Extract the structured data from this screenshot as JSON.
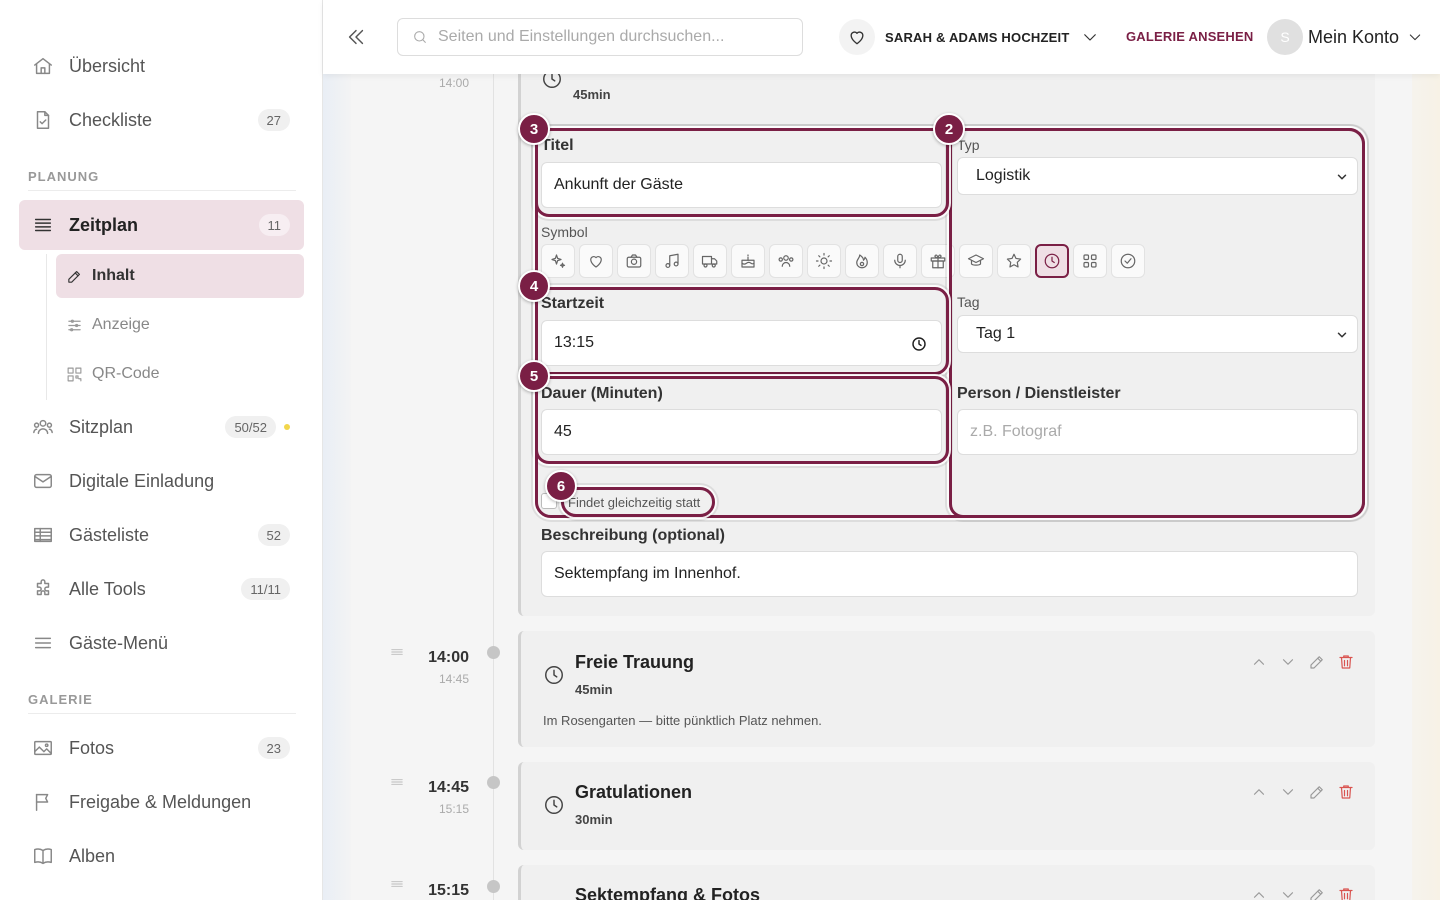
{
  "sidebar": {
    "items": [
      {
        "label": "Übersicht"
      },
      {
        "label": "Checkliste",
        "badge": "27"
      },
      {
        "label": "Zeitplan",
        "badge": "11"
      },
      {
        "label": "Sitzplan",
        "badge": "50/52"
      },
      {
        "label": "Digitale Einladung"
      },
      {
        "label": "Gästeliste",
        "badge": "52"
      },
      {
        "label": "Alle Tools",
        "badge": "11/11"
      },
      {
        "label": "Gäste-Menü"
      },
      {
        "label": "Fotos",
        "badge": "23"
      },
      {
        "label": "Freigabe & Meldungen"
      },
      {
        "label": "Alben"
      }
    ],
    "sub_items": [
      {
        "label": "Inhalt"
      },
      {
        "label": "Anzeige"
      },
      {
        "label": "QR-Code"
      }
    ],
    "sections": {
      "planung": "PLANUNG",
      "galerie": "GALERIE"
    }
  },
  "header": {
    "search_placeholder": "Seiten und Einstellungen durchsuchen...",
    "event_name": "SARAH & ADAMS HOCHZEIT",
    "gallery_link": "GALERIE ANSEHEN",
    "avatar_initial": "S",
    "account_label": "Mein Konto"
  },
  "timeline": {
    "top_sub_time": "14:00",
    "edit": {
      "duration_display": "45min",
      "title_label": "Titel",
      "title_value": "Ankunft der Gäste",
      "type_label": "Typ",
      "type_value": "Logistik",
      "symbol_label": "Symbol",
      "symbols": [
        "sparkles-icon",
        "heart-icon",
        "camera-icon",
        "music-icon",
        "truck-icon",
        "cake-icon",
        "users-icon",
        "sun-icon",
        "fire-icon",
        "microphone-icon",
        "gift-icon",
        "graduation-cap-icon",
        "star-icon",
        "clock-icon",
        "grid-icon",
        "check-circle-icon"
      ],
      "selected_symbol": "clock-icon",
      "start_label": "Startzeit",
      "start_value": "13:15",
      "day_label": "Tag",
      "day_value": "Tag 1",
      "duration_label": "Dauer (Minuten)",
      "duration_value": "45",
      "person_label": "Person / Dienstleister",
      "person_placeholder": "z.B. Fotograf",
      "simultaneous_label": "Findet gleichzeitig statt",
      "description_label": "Beschreibung (optional)",
      "description_value": "Sektempfang im Innenhof."
    },
    "entries": [
      {
        "time": "14:00",
        "end": "14:45",
        "title": "Freie Trauung",
        "duration": "45min",
        "description": "Im Rosengarten — bitte pünktlich Platz nehmen."
      },
      {
        "time": "14:45",
        "end": "15:15",
        "title": "Gratulationen",
        "duration": "30min"
      },
      {
        "time": "15:15",
        "title": "Sektempfang & Fotos"
      }
    ]
  },
  "highlights": [
    "3",
    "2",
    "4",
    "5",
    "6"
  ],
  "colors": {
    "accent": "#7a1f45",
    "accent_light": "#efdfe5",
    "danger": "#d9534f"
  }
}
